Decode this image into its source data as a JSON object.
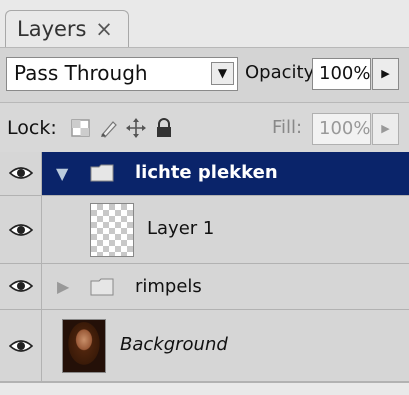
{
  "panel": {
    "tab_label": "Layers",
    "tab_close": "×"
  },
  "blend": {
    "value": "Pass Through",
    "dropdown_arrow": "▼"
  },
  "opacity": {
    "label": "Opacity:",
    "value": "100%",
    "arrow": "▶"
  },
  "lock": {
    "label": "Lock:"
  },
  "fill": {
    "label": "Fill:",
    "value": "100%",
    "arrow": "▶"
  },
  "layers": [
    {
      "name": "lichte plekken",
      "type": "group",
      "expanded": true,
      "selected": true,
      "visible": true,
      "icon": "folder-icon"
    },
    {
      "name": "Layer 1",
      "type": "layer",
      "selected": false,
      "visible": true,
      "icon": "transparent-thumbnail"
    },
    {
      "name": "rimpels",
      "type": "group",
      "expanded": false,
      "selected": false,
      "visible": true,
      "icon": "folder-icon"
    },
    {
      "name": "Background",
      "type": "background",
      "selected": false,
      "visible": true,
      "icon": "photo-thumbnail"
    }
  ],
  "colors": {
    "selection": "#0a246a",
    "panel_bg": "#d6d6d6"
  }
}
